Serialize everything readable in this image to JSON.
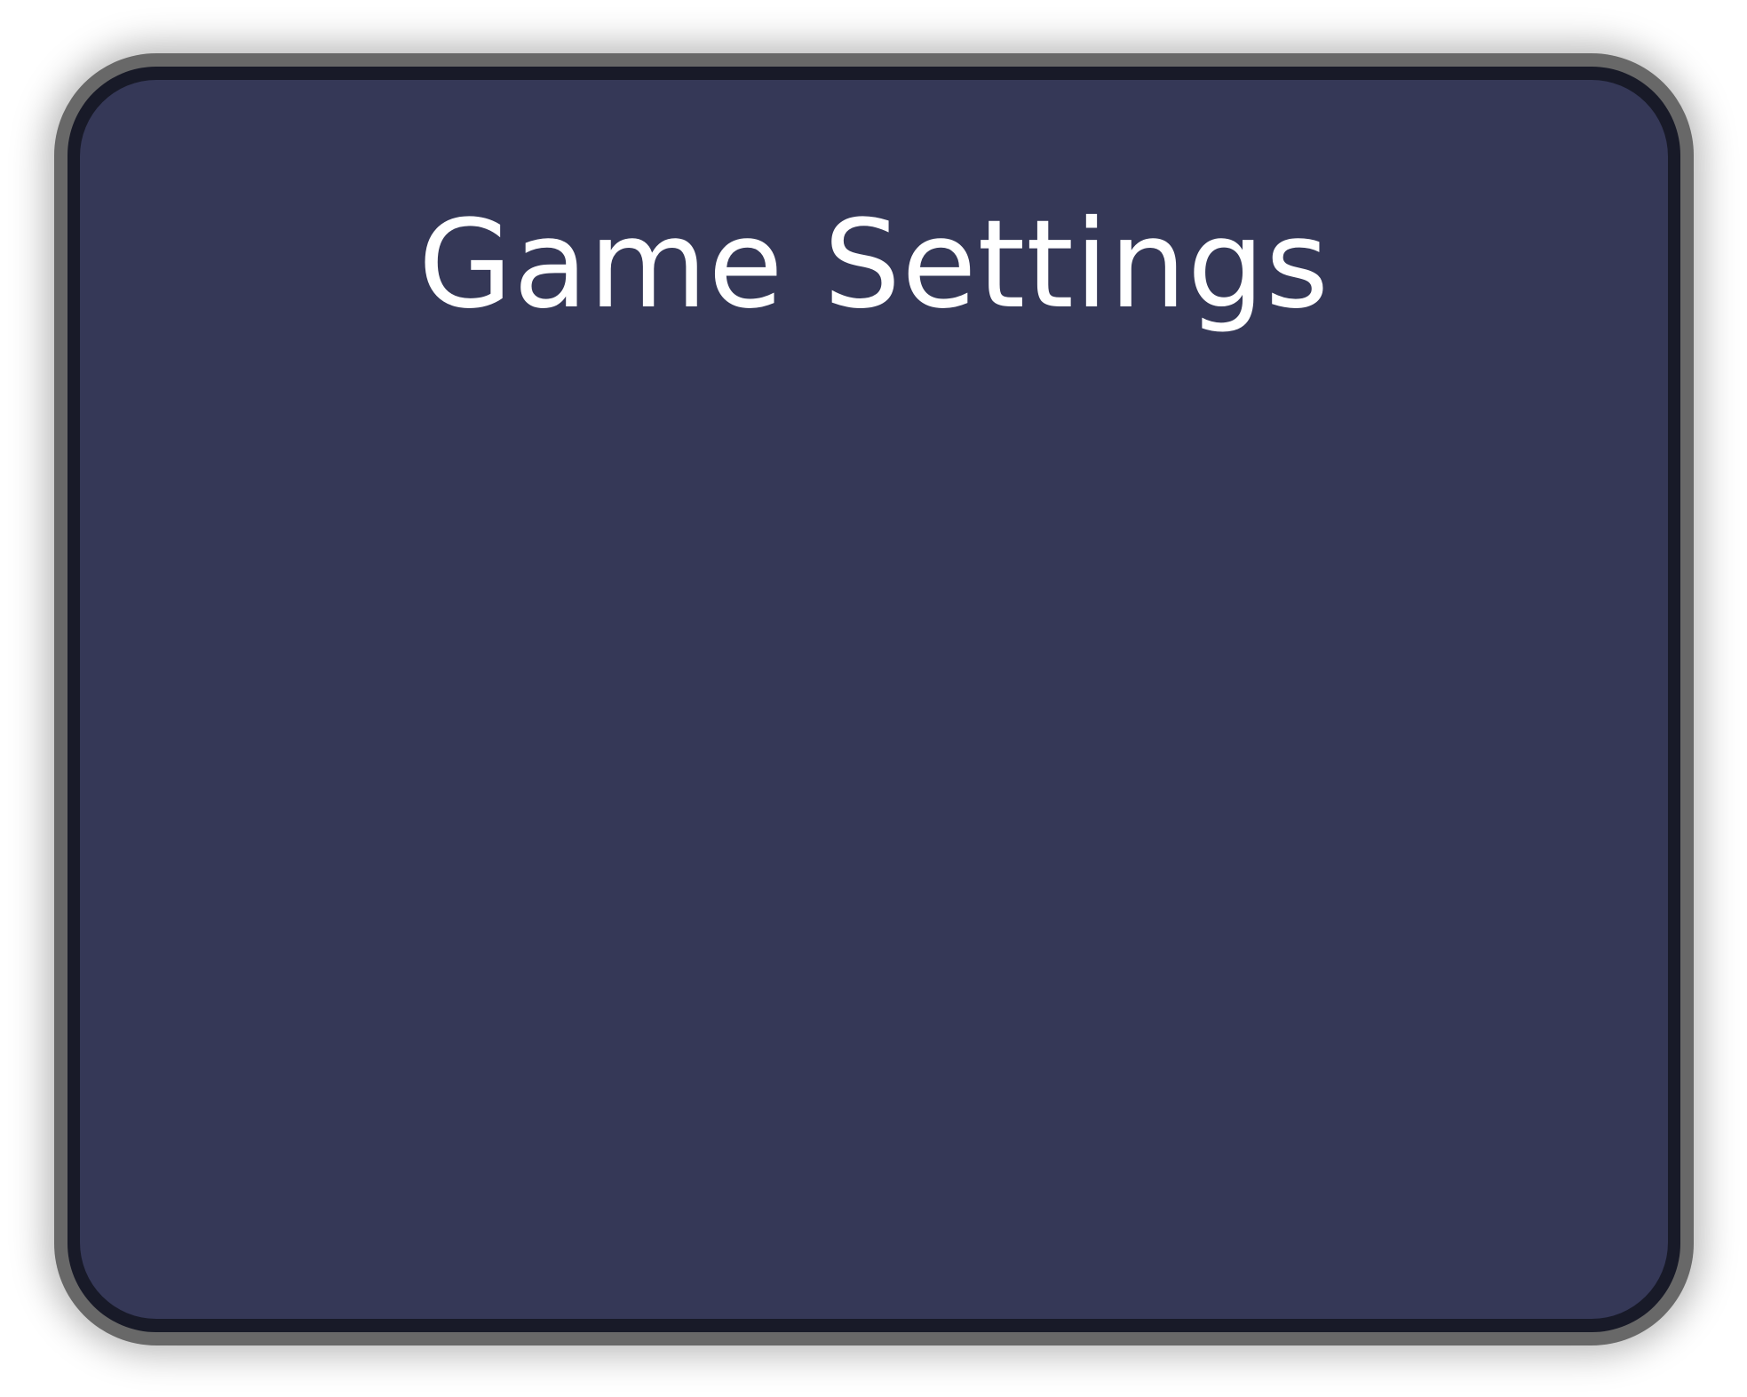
{
  "dialog": {
    "title": "Game Settings"
  },
  "colors": {
    "outer_border": "#686868",
    "inner_border": "#181a28",
    "panel_background": "#353857",
    "title_text": "#ffffff"
  }
}
